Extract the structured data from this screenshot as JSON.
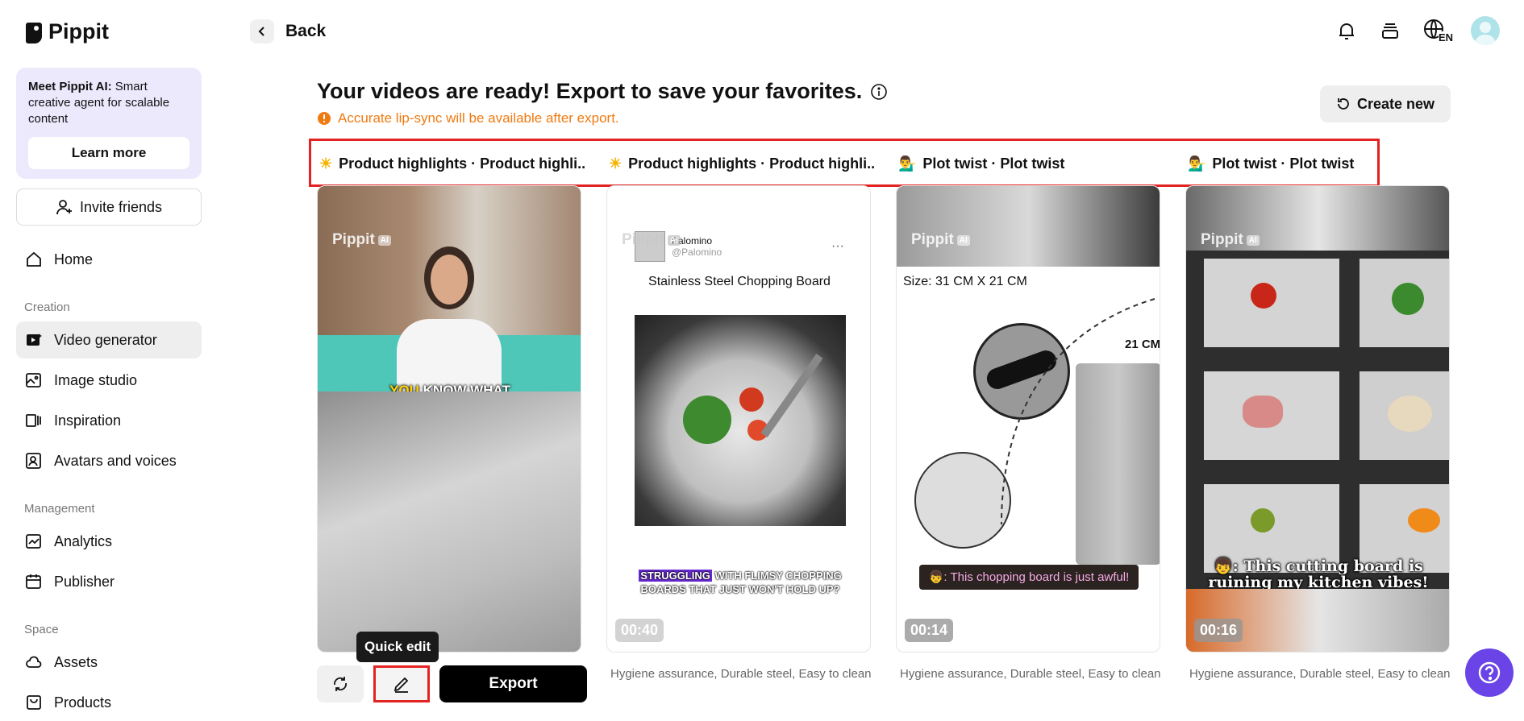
{
  "app": {
    "name": "Pippit"
  },
  "sidebar": {
    "promo": {
      "title": "Meet Pippit AI:",
      "text": "Smart creative agent for scalable content",
      "button": "Learn more"
    },
    "invite": "Invite friends",
    "home": "Home",
    "sections": {
      "creation": "Creation",
      "management": "Management",
      "space": "Space"
    },
    "items": {
      "video_generator": "Video generator",
      "image_studio": "Image studio",
      "inspiration": "Inspiration",
      "avatars": "Avatars and voices",
      "analytics": "Analytics",
      "publisher": "Publisher",
      "assets": "Assets",
      "products": "Products"
    }
  },
  "header": {
    "back": "Back",
    "lang": "EN"
  },
  "main": {
    "title": "Your videos are ready! Export to save your favorites.",
    "notice": "Accurate lip-sync will be available after export.",
    "create_new": "Create new",
    "tabs": [
      {
        "emoji": "☀",
        "label": "Product highlights · Product highli..."
      },
      {
        "emoji": "☀",
        "label": "Product highlights · Product highli..."
      },
      {
        "emoji": "💁‍♂️",
        "label": "Plot twist · Plot twist"
      },
      {
        "emoji": "💁‍♂️",
        "label": "Plot twist · Plot twist"
      }
    ],
    "watermark": "Pippit",
    "watermark_ai": "AI",
    "cards": [
      {
        "subtitle_a": "YOU",
        "subtitle_b": "KNOW WHAT",
        "caption": ""
      },
      {
        "duration": "00:40",
        "account_name": "Palomino",
        "account_handle": "@Palomino",
        "product_title": "Stainless Steel Chopping Board",
        "subtitle_highlight": "STRUGGLING",
        "subtitle_rest": "WITH FLIMSY CHOPPING BOARDS THAT JUST WON'T HOLD UP?",
        "caption": "Hygiene assurance, Durable steel, Easy to clean"
      },
      {
        "duration": "00:14",
        "size_label": "Size: 31 CM X 21 CM",
        "dim_label": "21 CM",
        "bubble": "👦: This chopping board is just awful!",
        "caption": "Hygiene assurance, Durable steel, Easy to clean"
      },
      {
        "duration": "00:16",
        "overlay": "👦: This cutting board is ruining my kitchen vibes!",
        "overlay_emoji": "😳",
        "caption": "Hygiene assurance, Durable steel, Easy to clean"
      }
    ],
    "tooltip": "Quick edit",
    "export": "Export"
  }
}
